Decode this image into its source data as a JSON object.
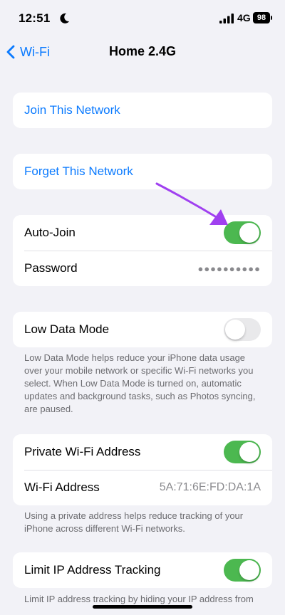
{
  "status_bar": {
    "time": "12:51",
    "network": "4G",
    "battery": "98",
    "icons": [
      "moon-icon",
      "signal-icon"
    ]
  },
  "nav": {
    "back_label": "Wi-Fi",
    "title": "Home 2.4G",
    "back_icon": "chevron-left-icon"
  },
  "actions": {
    "join": "Join This Network",
    "forget": "Forget This Network"
  },
  "auto_join": {
    "label": "Auto-Join",
    "enabled": true,
    "password_label": "Password",
    "password_value": "●●●●●●●●●●"
  },
  "low_data": {
    "label": "Low Data Mode",
    "enabled": false,
    "footnote": "Low Data Mode helps reduce your iPhone data usage over your mobile network or specific Wi-Fi networks you select. When Low Data Mode is turned on, automatic updates and background tasks, such as Photos syncing, are paused."
  },
  "private_address": {
    "label": "Private Wi-Fi Address",
    "enabled": true,
    "address_label": "Wi-Fi Address",
    "address_value": "5A:71:6E:FD:DA:1A",
    "footnote": "Using a private address helps reduce tracking of your iPhone across different Wi-Fi networks."
  },
  "ip_tracking": {
    "label": "Limit IP Address Tracking",
    "enabled": true,
    "footnote": "Limit IP address tracking by hiding your IP address from known trackers in Mail and Safari."
  },
  "colors": {
    "accent": "#0a7aff",
    "toggle_on": "#4cb850",
    "annotation_arrow": "#a040f0"
  }
}
